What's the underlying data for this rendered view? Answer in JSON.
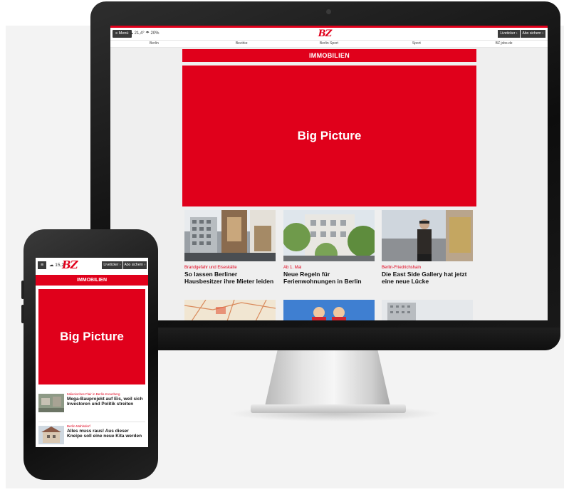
{
  "colors": {
    "brand_red": "#e0001b",
    "dark_button": "#3a3a3a"
  },
  "desktop": {
    "topbar": {
      "menu_label": "≡ Menü",
      "weather": "☁ 21,4° ☂ 20%",
      "logo": "BZ",
      "btn_liveticker": "Liveticker ›",
      "btn_abo": "Abo sichern ›"
    },
    "nav": [
      "Berlin",
      "Bezirke",
      "Berlin Sport",
      "Sport",
      "BZ jobs.de"
    ],
    "section_title": "IMMOBILIEN",
    "big_picture": "Big Picture",
    "cards": [
      {
        "kicker": "Brandgefahr und Eiseskälte",
        "title": "So lassen Berliner Hausbesitzer ihre Mieter leiden",
        "image": "building-interior-photo"
      },
      {
        "kicker": "Ab 1. Mai",
        "title": "Neue Regeln für Ferienwohnungen in Berlin",
        "image": "street-facade-photo"
      },
      {
        "kicker": "Berlin-Friedrichshain",
        "title": "Die East Side Gallery hat jetzt eine neue Lücke",
        "image": "gallery-wall-man-photo"
      }
    ],
    "row2_images": [
      "map-photo",
      "people-photo",
      "highrise-photo"
    ]
  },
  "mobile": {
    "topbar": {
      "menu_label": "≡",
      "weather": "☁ 15,2",
      "logo": "BZ",
      "btn_liveticker": "Liveticker ›",
      "btn_abo": "Abo sichern ›"
    },
    "section_title": "IMMOBILIEN",
    "big_picture": "Big Picture",
    "items": [
      {
        "kicker": "Italienisches Flair in Berlin-Kreuzberg",
        "title": "Mega-Bauprojekt auf Eis, weil sich Investoren und Politik streiten",
        "image": "aerial-photo"
      },
      {
        "kicker": "Berlin-Mahlsdorf",
        "title": "Alles muss raus! Aus dieser Kneipe soll eine neue Kita werden",
        "image": "house-photo"
      }
    ]
  }
}
